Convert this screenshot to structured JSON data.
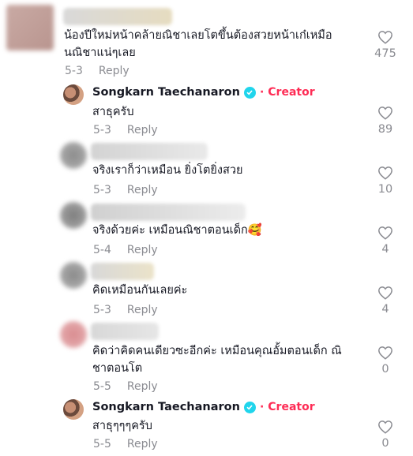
{
  "colors": {
    "creator": "#fe2c55",
    "verified": "#20d5ec",
    "meta": "#8a8b91",
    "text": "#161823"
  },
  "comments": [
    {
      "text_line1": "น้องปีใหม่หน้าคล้ายณิชาเลยโตขึ้นต้องสวยหน้าเก๋เหมือ",
      "text_line2": "นณิชาแน่ๆเลย",
      "date": "5-3",
      "reply": "Reply",
      "likes": "475"
    },
    {
      "author": "Songkarn Taechanaron",
      "badge": "Creator",
      "text": "สาธุครับ",
      "date": "5-3",
      "reply": "Reply",
      "likes": "89"
    },
    {
      "text": "จริงเราก็ว่าเหมือน ยิ่งโตยิ่งสวย",
      "date": "5-3",
      "reply": "Reply",
      "likes": "10"
    },
    {
      "text": "จริงด้วยค่ะ เหมือนณิชาตอนเด็ก🥰",
      "date": "5-4",
      "reply": "Reply",
      "likes": "4"
    },
    {
      "text": "คิดเหมือนกันเลยค่ะ",
      "date": "5-3",
      "reply": "Reply",
      "likes": "4"
    },
    {
      "text_line1": "คิดว่าคิดคนเดียวซะอีกค่ะ เหมือนคุณอั้มตอนเด็ก ณิ",
      "text_line2": "ชาตอนโต",
      "date": "5-5",
      "reply": "Reply",
      "likes": "0"
    },
    {
      "author": "Songkarn Taechanaron",
      "badge": "Creator",
      "text": "สาธุๆๆๆครับ",
      "date": "5-5",
      "reply": "Reply",
      "likes": "0"
    }
  ]
}
